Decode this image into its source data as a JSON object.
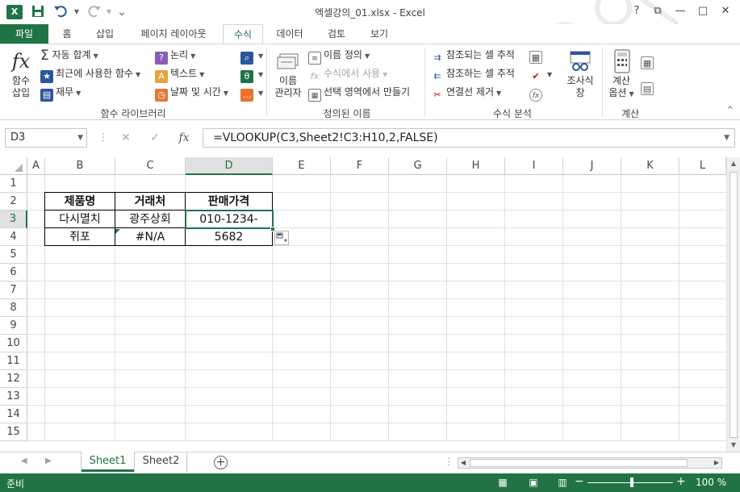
{
  "window": {
    "title": "엑셀강의_01.xlsx - Excel",
    "logo": "X",
    "help": "?",
    "restore": "⧉",
    "minimize": "—",
    "maximize": "□",
    "close": "✕"
  },
  "qat": {
    "save_icon": "save-icon",
    "undo_icon": "undo-icon",
    "redo_icon": "redo-icon",
    "customize": "⌄"
  },
  "tabs": [
    "파일",
    "홈",
    "삽입",
    "페이지 레이아웃",
    "수식",
    "데이터",
    "검토",
    "보기"
  ],
  "active_tab": "수식",
  "ribbon": {
    "insert_function": [
      "함수",
      "삽입"
    ],
    "autosum": "자동 합계",
    "recent": "최근에 사용한 함수",
    "financial": "재무",
    "logical": "논리",
    "text": "텍스트",
    "datetime": "날짜 및 시간",
    "group1_label": "함수 라이브러리",
    "name_manager": [
      "이름",
      "관리자"
    ],
    "define_name": "이름 정의",
    "use_in_formula": "수식에서 사용",
    "create_from_selection": "선택 영역에서 만들기",
    "group2_label": "정의된 이름",
    "trace_precedents": "참조되는 셀 추적",
    "trace_dependents": "참조하는 셀 추적",
    "remove_arrows": "연결선 제거",
    "group3_label": "수식 분석",
    "watch_window": [
      "조사식",
      "창"
    ],
    "calc_options": [
      "계산",
      "옵션"
    ],
    "group4_label": "계산",
    "collapse": "^"
  },
  "formula_bar": {
    "name_box": "D3",
    "cancel": "✕",
    "enter": "✓",
    "fx": "fx",
    "formula": "=VLOOKUP(C3,Sheet2!C3:H10,2,FALSE)"
  },
  "grid": {
    "columns": [
      "A",
      "B",
      "C",
      "D",
      "E",
      "F",
      "G",
      "H",
      "I",
      "J",
      "K",
      "L"
    ],
    "rows": [
      "1",
      "2",
      "3",
      "4",
      "5",
      "6",
      "7",
      "8",
      "9",
      "10",
      "11",
      "12",
      "13",
      "14",
      "15"
    ],
    "selected_column": "D",
    "selected_row": "3",
    "cells": {
      "B2": "제품명",
      "C2": "거래처",
      "D2": "판매가격",
      "B3": "다시멸치",
      "C3": "광주상회",
      "D3": "010-1234-5682",
      "B4": "쥐포",
      "C4": "#N/A",
      "D4": ""
    }
  },
  "sheets": [
    "Sheet1",
    "Sheet2"
  ],
  "active_sheet": "Sheet1",
  "add_sheet": "+",
  "status": {
    "mode": "준비",
    "zoom_minus": "−",
    "zoom_plus": "+",
    "zoom": "100 %"
  },
  "colors": {
    "accent": "#217346",
    "gridline": "#e1e1e1"
  }
}
